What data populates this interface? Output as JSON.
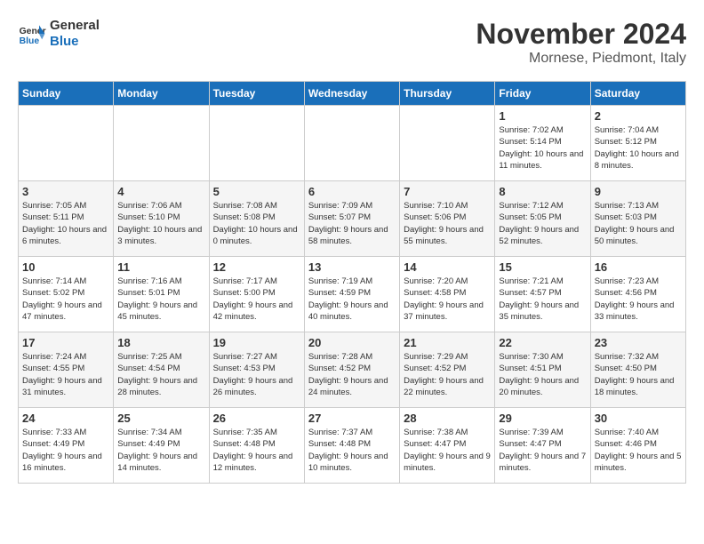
{
  "header": {
    "logo_line1": "General",
    "logo_line2": "Blue",
    "month_title": "November 2024",
    "location": "Mornese, Piedmont, Italy"
  },
  "days_of_week": [
    "Sunday",
    "Monday",
    "Tuesday",
    "Wednesday",
    "Thursday",
    "Friday",
    "Saturday"
  ],
  "weeks": [
    [
      {
        "day": "",
        "info": ""
      },
      {
        "day": "",
        "info": ""
      },
      {
        "day": "",
        "info": ""
      },
      {
        "day": "",
        "info": ""
      },
      {
        "day": "",
        "info": ""
      },
      {
        "day": "1",
        "info": "Sunrise: 7:02 AM\nSunset: 5:14 PM\nDaylight: 10 hours and 11 minutes."
      },
      {
        "day": "2",
        "info": "Sunrise: 7:04 AM\nSunset: 5:12 PM\nDaylight: 10 hours and 8 minutes."
      }
    ],
    [
      {
        "day": "3",
        "info": "Sunrise: 7:05 AM\nSunset: 5:11 PM\nDaylight: 10 hours and 6 minutes."
      },
      {
        "day": "4",
        "info": "Sunrise: 7:06 AM\nSunset: 5:10 PM\nDaylight: 10 hours and 3 minutes."
      },
      {
        "day": "5",
        "info": "Sunrise: 7:08 AM\nSunset: 5:08 PM\nDaylight: 10 hours and 0 minutes."
      },
      {
        "day": "6",
        "info": "Sunrise: 7:09 AM\nSunset: 5:07 PM\nDaylight: 9 hours and 58 minutes."
      },
      {
        "day": "7",
        "info": "Sunrise: 7:10 AM\nSunset: 5:06 PM\nDaylight: 9 hours and 55 minutes."
      },
      {
        "day": "8",
        "info": "Sunrise: 7:12 AM\nSunset: 5:05 PM\nDaylight: 9 hours and 52 minutes."
      },
      {
        "day": "9",
        "info": "Sunrise: 7:13 AM\nSunset: 5:03 PM\nDaylight: 9 hours and 50 minutes."
      }
    ],
    [
      {
        "day": "10",
        "info": "Sunrise: 7:14 AM\nSunset: 5:02 PM\nDaylight: 9 hours and 47 minutes."
      },
      {
        "day": "11",
        "info": "Sunrise: 7:16 AM\nSunset: 5:01 PM\nDaylight: 9 hours and 45 minutes."
      },
      {
        "day": "12",
        "info": "Sunrise: 7:17 AM\nSunset: 5:00 PM\nDaylight: 9 hours and 42 minutes."
      },
      {
        "day": "13",
        "info": "Sunrise: 7:19 AM\nSunset: 4:59 PM\nDaylight: 9 hours and 40 minutes."
      },
      {
        "day": "14",
        "info": "Sunrise: 7:20 AM\nSunset: 4:58 PM\nDaylight: 9 hours and 37 minutes."
      },
      {
        "day": "15",
        "info": "Sunrise: 7:21 AM\nSunset: 4:57 PM\nDaylight: 9 hours and 35 minutes."
      },
      {
        "day": "16",
        "info": "Sunrise: 7:23 AM\nSunset: 4:56 PM\nDaylight: 9 hours and 33 minutes."
      }
    ],
    [
      {
        "day": "17",
        "info": "Sunrise: 7:24 AM\nSunset: 4:55 PM\nDaylight: 9 hours and 31 minutes."
      },
      {
        "day": "18",
        "info": "Sunrise: 7:25 AM\nSunset: 4:54 PM\nDaylight: 9 hours and 28 minutes."
      },
      {
        "day": "19",
        "info": "Sunrise: 7:27 AM\nSunset: 4:53 PM\nDaylight: 9 hours and 26 minutes."
      },
      {
        "day": "20",
        "info": "Sunrise: 7:28 AM\nSunset: 4:52 PM\nDaylight: 9 hours and 24 minutes."
      },
      {
        "day": "21",
        "info": "Sunrise: 7:29 AM\nSunset: 4:52 PM\nDaylight: 9 hours and 22 minutes."
      },
      {
        "day": "22",
        "info": "Sunrise: 7:30 AM\nSunset: 4:51 PM\nDaylight: 9 hours and 20 minutes."
      },
      {
        "day": "23",
        "info": "Sunrise: 7:32 AM\nSunset: 4:50 PM\nDaylight: 9 hours and 18 minutes."
      }
    ],
    [
      {
        "day": "24",
        "info": "Sunrise: 7:33 AM\nSunset: 4:49 PM\nDaylight: 9 hours and 16 minutes."
      },
      {
        "day": "25",
        "info": "Sunrise: 7:34 AM\nSunset: 4:49 PM\nDaylight: 9 hours and 14 minutes."
      },
      {
        "day": "26",
        "info": "Sunrise: 7:35 AM\nSunset: 4:48 PM\nDaylight: 9 hours and 12 minutes."
      },
      {
        "day": "27",
        "info": "Sunrise: 7:37 AM\nSunset: 4:48 PM\nDaylight: 9 hours and 10 minutes."
      },
      {
        "day": "28",
        "info": "Sunrise: 7:38 AM\nSunset: 4:47 PM\nDaylight: 9 hours and 9 minutes."
      },
      {
        "day": "29",
        "info": "Sunrise: 7:39 AM\nSunset: 4:47 PM\nDaylight: 9 hours and 7 minutes."
      },
      {
        "day": "30",
        "info": "Sunrise: 7:40 AM\nSunset: 4:46 PM\nDaylight: 9 hours and 5 minutes."
      }
    ]
  ]
}
